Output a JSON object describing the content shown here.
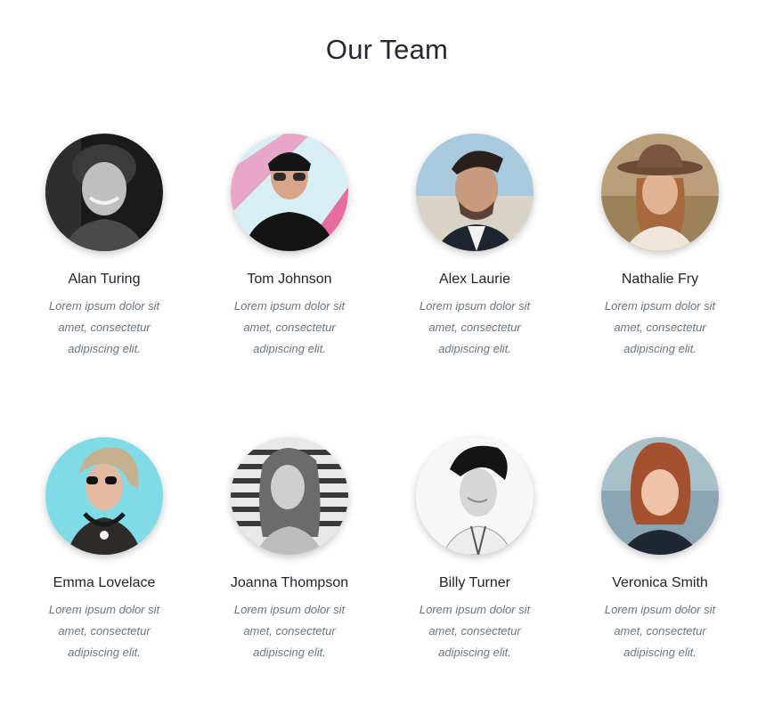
{
  "header": {
    "title": "Our Team"
  },
  "team": [
    {
      "name": "Alan Turing",
      "bio": "Lorem ipsum dolor sit amet, consectetur adipiscing elit.",
      "photo": "portrait-photo"
    },
    {
      "name": "Tom Johnson",
      "bio": "Lorem ipsum dolor sit amet, consectetur adipiscing elit.",
      "photo": "portrait-photo"
    },
    {
      "name": "Alex Laurie",
      "bio": "Lorem ipsum dolor sit amet, consectetur adipiscing elit.",
      "photo": "portrait-photo"
    },
    {
      "name": "Nathalie Fry",
      "bio": "Lorem ipsum dolor sit amet, consectetur adipiscing elit.",
      "photo": "portrait-photo"
    },
    {
      "name": "Emma Lovelace",
      "bio": "Lorem ipsum dolor sit amet, consectetur adipiscing elit.",
      "photo": "portrait-photo"
    },
    {
      "name": "Joanna Thompson",
      "bio": "Lorem ipsum dolor sit amet, consectetur adipiscing elit.",
      "photo": "portrait-photo"
    },
    {
      "name": "Billy Turner",
      "bio": "Lorem ipsum dolor sit amet, consectetur adipiscing elit.",
      "photo": "portrait-photo"
    },
    {
      "name": "Veronica Smith",
      "bio": "Lorem ipsum dolor sit amet, consectetur adipiscing elit.",
      "photo": "portrait-photo"
    }
  ],
  "colors": {
    "title": "#25282c",
    "name": "#212529",
    "bio": "#6c757d",
    "background": "#ffffff"
  }
}
